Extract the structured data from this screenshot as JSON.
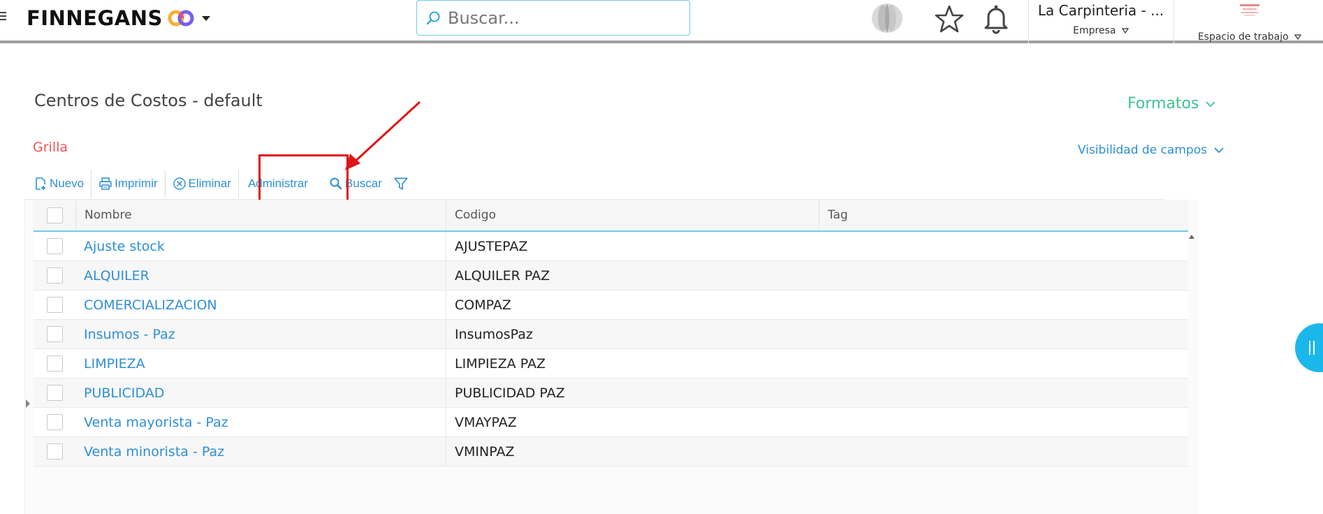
{
  "header": {
    "brand": "FINNEGANS",
    "search_placeholder": "Buscar...",
    "company_name": "La Carpinteria - ...",
    "company_label": "Empresa",
    "workspace_label": "Espacio de trabajo"
  },
  "page": {
    "title": "Centros de Costos - default",
    "formats_label": "Formatos",
    "tab": "Grilla",
    "field_visibility_label": "Visibilidad de campos"
  },
  "toolbar": {
    "new_label": "Nuevo",
    "print_label": "Imprimir",
    "delete_label": "Eliminar",
    "manage_label": "Administrar",
    "search_label": "Buscar"
  },
  "grid": {
    "columns": [
      "Nombre",
      "Codigo",
      "Tag"
    ],
    "rows": [
      {
        "nombre": "Ajuste stock",
        "codigo": "AJUSTEPAZ",
        "tag": ""
      },
      {
        "nombre": "ALQUILER",
        "codigo": "ALQUILER PAZ",
        "tag": ""
      },
      {
        "nombre": "COMERCIALIZACION",
        "codigo": "COMPAZ",
        "tag": ""
      },
      {
        "nombre": "Insumos - Paz",
        "codigo": "InsumosPaz",
        "tag": ""
      },
      {
        "nombre": "LIMPIEZA",
        "codigo": "LIMPIEZA PAZ",
        "tag": ""
      },
      {
        "nombre": "PUBLICIDAD",
        "codigo": "PUBLICIDAD PAZ",
        "tag": ""
      },
      {
        "nombre": "Venta mayorista - Paz",
        "codigo": "VMAYPAZ",
        "tag": ""
      },
      {
        "nombre": "Venta minorista - Paz",
        "codigo": "VMINPAZ",
        "tag": ""
      }
    ]
  },
  "colors": {
    "accent_blue": "#2e8fd6",
    "tab_red": "#f05656",
    "formats_green": "#3ec28f",
    "annotation_red": "#e01515",
    "handle_cyan": "#1ab8ea"
  },
  "icons": [
    "menu-icon",
    "finnegans-co-logo",
    "chevron-down-icon",
    "search-icon",
    "avatar-blob-icon",
    "star-icon",
    "bell-icon",
    "workspace-logo",
    "new-doc-icon",
    "printer-icon",
    "delete-circle-icon",
    "magnifier-icon",
    "filter-icon"
  ]
}
